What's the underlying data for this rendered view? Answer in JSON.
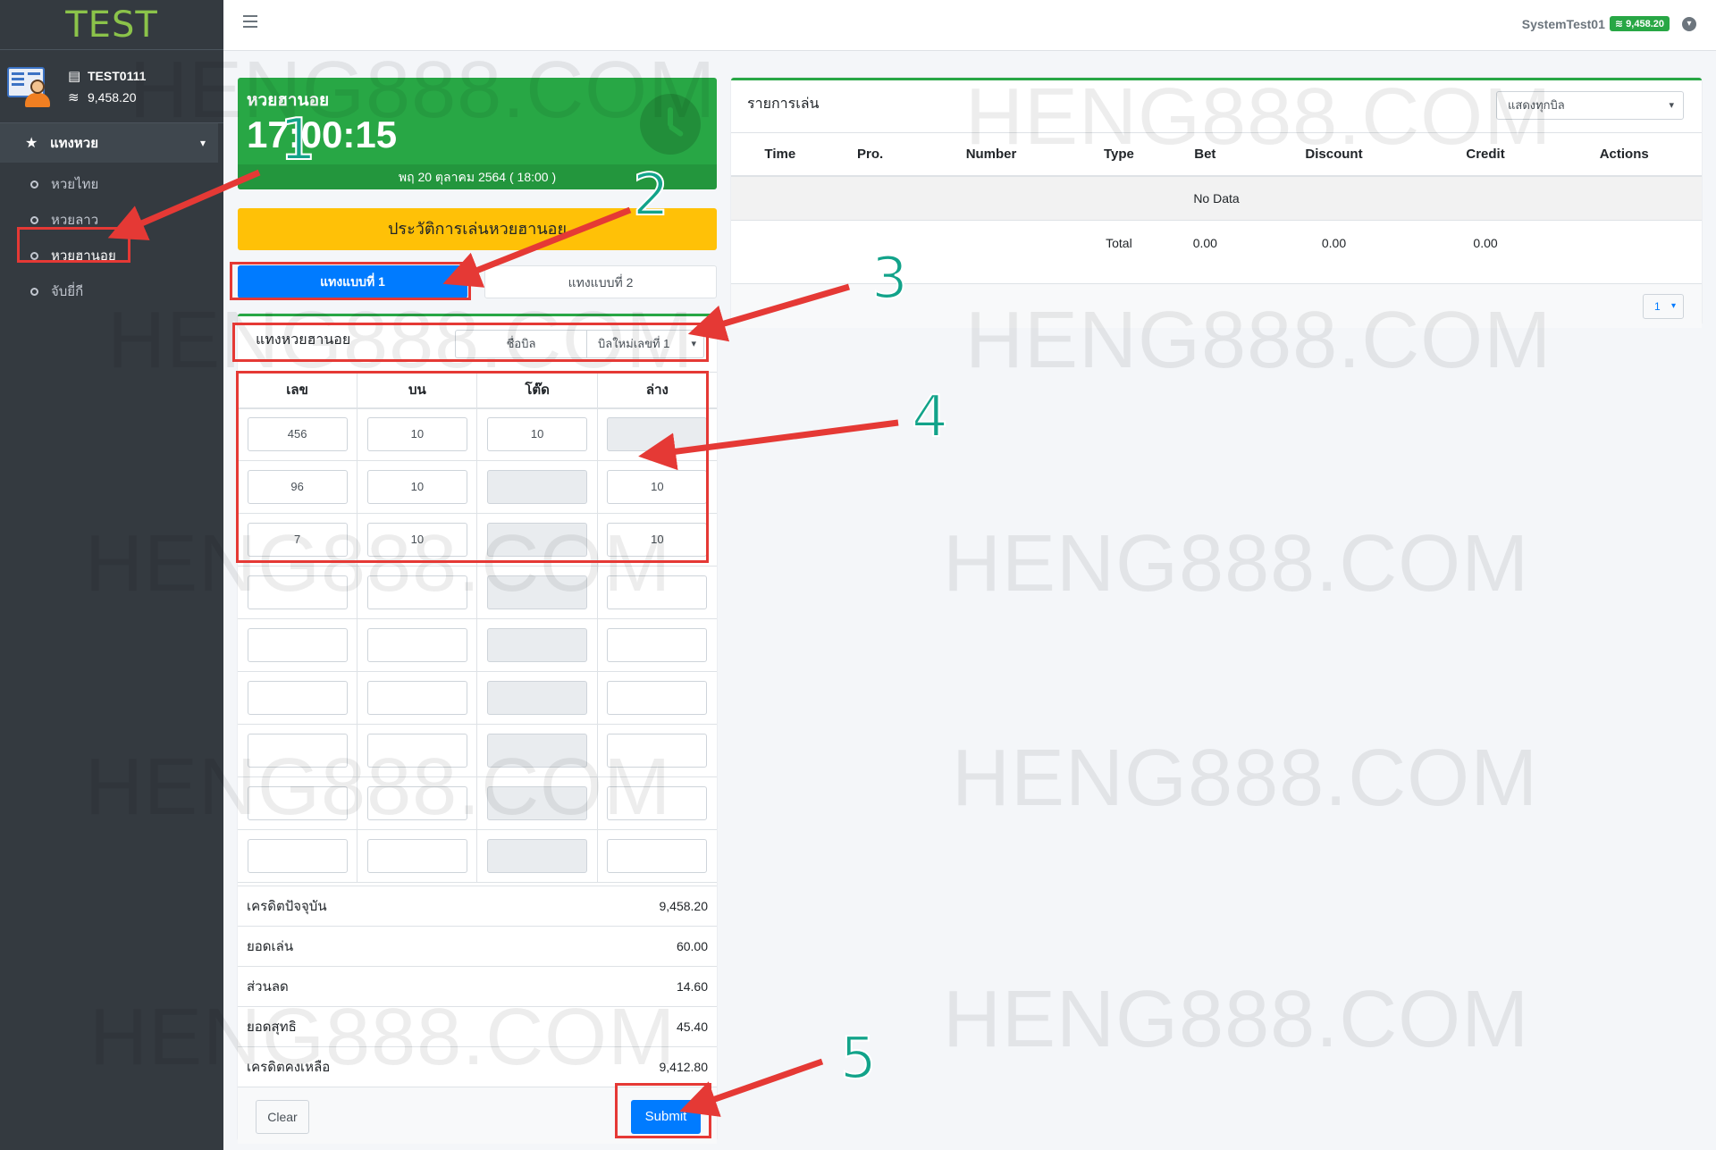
{
  "brand": "TEST",
  "user": {
    "name": "TEST0111",
    "balance": "9,458.20"
  },
  "sidebar": {
    "menu_title": "แทงหวย",
    "items": [
      {
        "label": "หวยไทย"
      },
      {
        "label": "หวยลาว"
      },
      {
        "label": "หวยฮานอย"
      },
      {
        "label": "จับยี่กี"
      }
    ]
  },
  "topbar": {
    "username": "SystemTest01",
    "balance": "9,458.20"
  },
  "lottery": {
    "name": "หวยฮานอย",
    "countdown": "17:00:15",
    "date": "พฤ 20 ตุลาคม 2564 ( 18:00 )"
  },
  "history_button": "ประวัติการเล่นหวยฮานอย",
  "tabs": [
    {
      "label": "แทงแบบที่ 1"
    },
    {
      "label": "แทงแบบที่ 2"
    }
  ],
  "bet_form": {
    "title": "แทงหวยฮานอย",
    "bill_name_placeholder": "ชื่อบิล",
    "bill_select": "บิลใหม่เลขที่ 1",
    "columns": [
      "เลข",
      "บน",
      "โต๊ด",
      "ล่าง"
    ],
    "rows": [
      [
        "456",
        "10",
        "10",
        ""
      ],
      [
        "96",
        "10",
        "",
        "10"
      ],
      [
        "7",
        "10",
        "",
        "10"
      ],
      [
        "",
        "",
        "",
        ""
      ],
      [
        "",
        "",
        "",
        ""
      ],
      [
        "",
        "",
        "",
        ""
      ],
      [
        "",
        "",
        "",
        ""
      ],
      [
        "",
        "",
        "",
        ""
      ],
      [
        "",
        "",
        "",
        ""
      ]
    ],
    "disabled": [
      [
        false,
        false,
        false,
        true
      ],
      [
        false,
        false,
        true,
        false
      ],
      [
        false,
        false,
        true,
        false
      ],
      [
        false,
        false,
        true,
        false
      ],
      [
        false,
        false,
        true,
        false
      ],
      [
        false,
        false,
        true,
        false
      ],
      [
        false,
        false,
        true,
        false
      ],
      [
        false,
        false,
        true,
        false
      ],
      [
        false,
        false,
        true,
        false
      ]
    ]
  },
  "summary": [
    {
      "label": "เครดิตปัจจุบัน",
      "value": "9,458.20"
    },
    {
      "label": "ยอดเล่น",
      "value": "60.00"
    },
    {
      "label": "ส่วนลด",
      "value": "14.60"
    },
    {
      "label": "ยอดสุทธิ",
      "value": "45.40"
    },
    {
      "label": "เครดิตคงเหลือ",
      "value": "9,412.80"
    }
  ],
  "buttons": {
    "clear": "Clear",
    "submit": "Submit"
  },
  "bet_list": {
    "title": "รายการเล่น",
    "filter": "แสดงทุกบิล",
    "columns": [
      "Time",
      "Pro.",
      "Number",
      "Type",
      "Bet",
      "Discount",
      "Credit",
      "Actions"
    ],
    "empty_text": "No Data",
    "total_label": "Total",
    "total_bet": "0.00",
    "total_discount": "0.00",
    "total_credit": "0.00",
    "page": "1"
  },
  "watermark": "HENG888.COM",
  "annotations": [
    "1",
    "2",
    "3",
    "4",
    "5"
  ],
  "colors": {
    "sidebar": "#343a40",
    "success": "#28a745",
    "primary": "#007bff",
    "warning": "#ffc107",
    "annotation": "#e53935"
  }
}
